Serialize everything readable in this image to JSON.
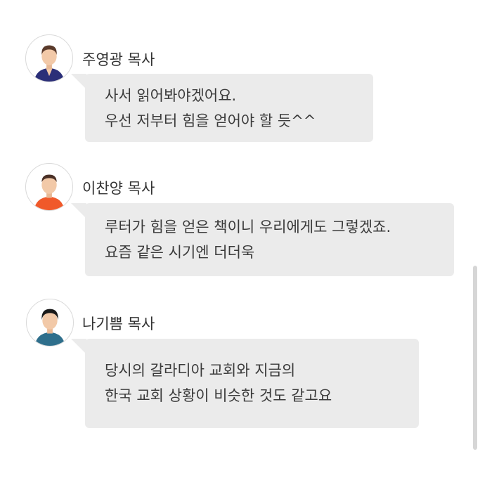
{
  "messages": [
    {
      "author": "주영광 목사",
      "avatar_icon": "man-navy-shirt-avatar-icon",
      "lines": [
        "사서 읽어봐야겠어요.",
        "우선 저부터 힘을 얻어야 할 듯^^"
      ]
    },
    {
      "author": "이찬양 목사",
      "avatar_icon": "man-orange-shirt-avatar-icon",
      "lines": [
        "루터가 힘을 얻은 책이니 우리에게도 그렇겠죠.",
        "요즘 같은 시기엔 더더욱"
      ]
    },
    {
      "author": "나기쁨 목사",
      "avatar_icon": "man-teal-shirt-avatar-icon",
      "lines": [
        "당시의 갈라디아 교회와 지금의",
        "한국 교회 상황이 비슷한 것도 같고요"
      ]
    }
  ],
  "colors": {
    "bubble": "#ebebeb",
    "text": "#3a3a3a",
    "navy_shirt": "#2b2f78",
    "orange_shirt": "#f0592a",
    "teal_shirt": "#2f6f8c"
  }
}
